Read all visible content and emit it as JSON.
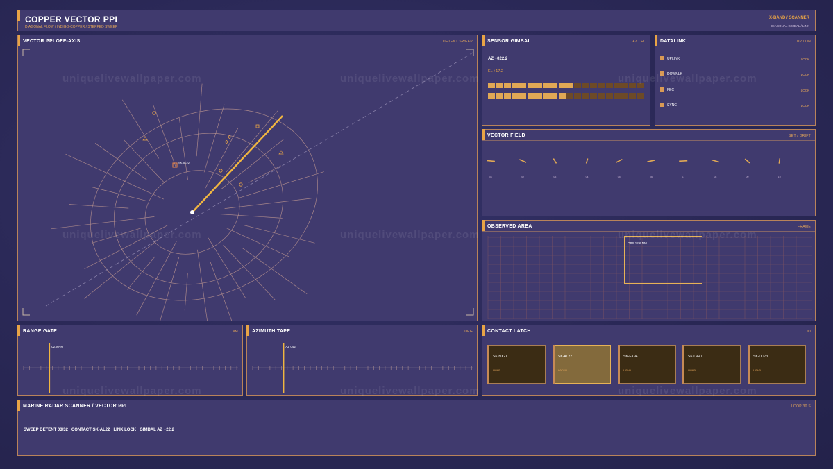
{
  "header": {
    "title": "COPPER VECTOR PPI",
    "subtitle": "DIAGONAL FLOW  /  INDIGO-COPPER  /  STEPPED SWEEP",
    "right_title": "X-BAND  /  SCANNER",
    "right_sub": "DIAGONAL  GIMBAL / LINK"
  },
  "ppi": {
    "title": "VECTOR PPI  OFF-AXIS",
    "tag": "DETENT SWEEP",
    "contact_label": "SK-AL22"
  },
  "gimbal": {
    "title": "SENSOR GIMBAL",
    "tag": "AZ / EL",
    "az": "AZ  +022.2",
    "el": "EL  +17.2",
    "az_fill": 0.55,
    "el_fill": 0.49
  },
  "datalink": {
    "title": "DATALINK",
    "tag": "UP / DN",
    "rows": [
      {
        "label": "UPLINK",
        "status": "LOCK"
      },
      {
        "label": "DOWNLK",
        "status": "LOCK"
      },
      {
        "label": "FEC",
        "status": "LOCK"
      },
      {
        "label": "SYNC",
        "status": "LOCK"
      }
    ]
  },
  "vector_field": {
    "title": "VECTOR FIELD",
    "tag": "SET / DRIFT",
    "labels": [
      "01",
      "02",
      "03",
      "04",
      "05",
      "06",
      "07",
      "08",
      "09",
      "10"
    ],
    "angles_deg": [
      10,
      35,
      70,
      100,
      140,
      160,
      175,
      25,
      55,
      95
    ]
  },
  "observed": {
    "title": "OBSERVED AREA",
    "tag": "FRAME",
    "box_label": "OBS  12.6 NM"
  },
  "range_gate": {
    "title": "RANGE GATE",
    "tag": "NM",
    "value": "02.9 NM",
    "fraction": 0.12
  },
  "azimuth_tape": {
    "title": "AZIMUTH TAPE",
    "tag": "DEG",
    "value": "AZ 042",
    "fraction": 0.14
  },
  "contact_latch": {
    "title": "CONTACT LATCH",
    "tag": "ID",
    "cards": [
      {
        "name": "SK-NX21",
        "status": "HOLD"
      },
      {
        "name": "SK-AL22",
        "status": "LATCH"
      },
      {
        "name": "SK-EK94",
        "status": "HOLD"
      },
      {
        "name": "SK-CA47",
        "status": "HOLD"
      },
      {
        "name": "SK-DU73",
        "status": "HOLD"
      }
    ]
  },
  "footer": {
    "title": "MARINE RADAR SCANNER  /  VECTOR PPI",
    "tag": "LOOP 30 S",
    "status": "SWEEP DETENT 03/32   CONTACT SK-AL22   LINK LOCK   GIMBAL AZ +22.2"
  },
  "watermark": "uniquelivewallpaper.com",
  "colors": {
    "accent": "#e8a446",
    "border": "#b9835a",
    "panel": "#403a6e"
  }
}
